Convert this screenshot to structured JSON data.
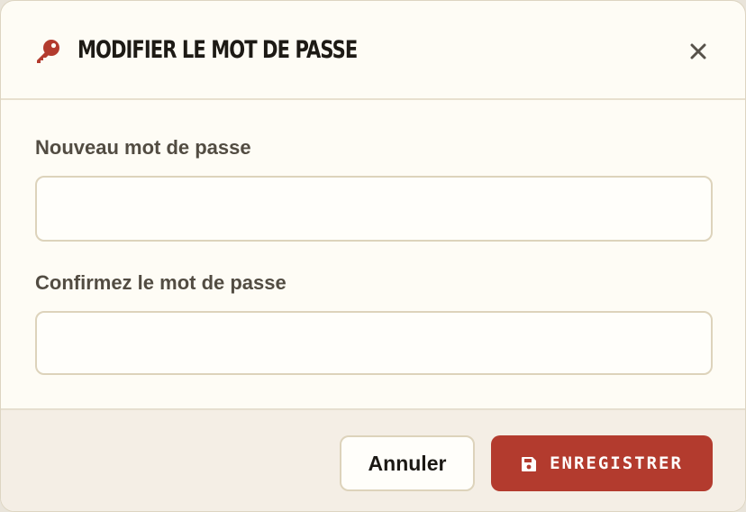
{
  "dialog": {
    "title": "MODIFIER LE MOT DE PASSE",
    "icon": "key-icon",
    "close_icon": "close-icon"
  },
  "form": {
    "new_password_label": "Nouveau mot de passe",
    "new_password_value": "",
    "confirm_password_label": "Confirmez le mot de passe",
    "confirm_password_value": ""
  },
  "actions": {
    "cancel_label": "Annuler",
    "save_label": "ENREGISTRER",
    "save_icon": "floppy-disk-icon"
  },
  "colors": {
    "accent": "#b33b2e",
    "background": "#fefcf5",
    "footer": "#f4eee5",
    "border": "#ddd3bb"
  }
}
